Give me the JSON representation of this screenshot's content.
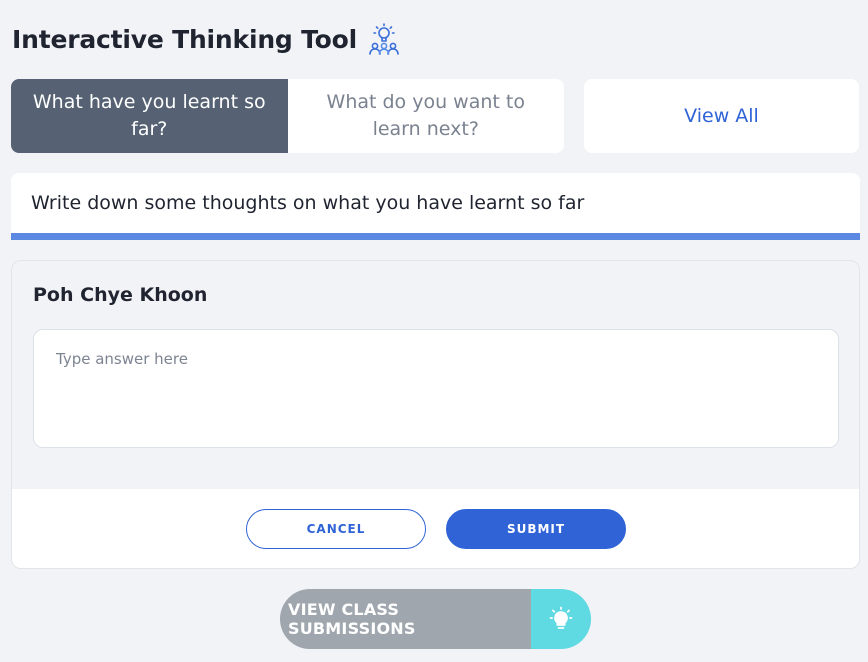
{
  "header": {
    "title": "Interactive Thinking Tool",
    "icon": "lightbulb-people-icon"
  },
  "tabs": [
    {
      "label": "What have you learnt so far?",
      "active": true
    },
    {
      "label": "What do you want to learn next?",
      "active": false
    }
  ],
  "view_all": {
    "label": "View All"
  },
  "prompt": {
    "text": "Write down some thoughts on what you have learnt so far"
  },
  "response_card": {
    "author": "Poh Chye Khoon",
    "answer_value": "",
    "answer_placeholder": "Type answer here",
    "cancel_label": "CANCEL",
    "submit_label": "SUBMIT"
  },
  "class_submissions": {
    "label": "VIEW CLASS SUBMISSIONS",
    "icon": "lightbulb-icon"
  },
  "colors": {
    "accent": "#2f63d6",
    "tab_active_bg": "#566273",
    "prompt_underline": "#5b88e0",
    "vcs_bg": "#9fa6ae",
    "vcs_icon_bg": "#5fd9e2",
    "page_bg": "#f2f3f7"
  }
}
